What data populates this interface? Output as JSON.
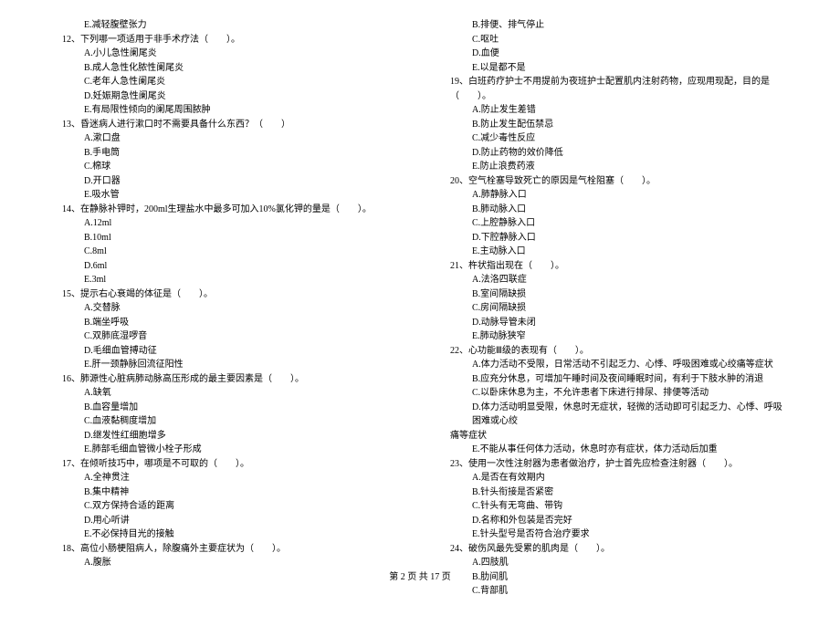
{
  "left_column": [
    {
      "type": "option",
      "text": "E.减轻腹壁张力"
    },
    {
      "type": "question",
      "text": "12、下列哪一项适用于非手术疗法（　　）。"
    },
    {
      "type": "option",
      "text": "A.小儿急性阑尾炎"
    },
    {
      "type": "option",
      "text": "B.成人急性化脓性阑尾炎"
    },
    {
      "type": "option",
      "text": "C.老年人急性阑尾炎"
    },
    {
      "type": "option",
      "text": "D.妊娠期急性阑尾炎"
    },
    {
      "type": "option",
      "text": "E.有局限性倾向的阑尾周围脓肿"
    },
    {
      "type": "question",
      "text": "13、昏迷病人进行漱口时不需要具备什么东西？（　　）"
    },
    {
      "type": "option",
      "text": "A.漱口盘"
    },
    {
      "type": "option",
      "text": "B.手电筒"
    },
    {
      "type": "option",
      "text": "C.棉球"
    },
    {
      "type": "option",
      "text": "D.开口器"
    },
    {
      "type": "option",
      "text": "E.吸水管"
    },
    {
      "type": "question",
      "text": "14、在静脉补钾时，200ml生理盐水中最多可加入10%氯化钾的量是（　　）。"
    },
    {
      "type": "option",
      "text": "A.12ml"
    },
    {
      "type": "option",
      "text": "B.10ml"
    },
    {
      "type": "option",
      "text": "C.8ml"
    },
    {
      "type": "option",
      "text": "D.6ml"
    },
    {
      "type": "option",
      "text": "E.3ml"
    },
    {
      "type": "question",
      "text": "15、提示右心衰竭的体征是（　　）。"
    },
    {
      "type": "option",
      "text": "A.交替脉"
    },
    {
      "type": "option",
      "text": "B.端坐呼吸"
    },
    {
      "type": "option",
      "text": "C.双肺底湿啰音"
    },
    {
      "type": "option",
      "text": "D.毛细血管搏动征"
    },
    {
      "type": "option",
      "text": "E.肝一颈静脉回流征阳性"
    },
    {
      "type": "question",
      "text": "16、肺源性心脏病肺动脉高压形成的最主要因素是（　　）。"
    },
    {
      "type": "option",
      "text": "A.缺氧"
    },
    {
      "type": "option",
      "text": "B.血容量增加"
    },
    {
      "type": "option",
      "text": "C.血液黏稠度增加"
    },
    {
      "type": "option",
      "text": "D.继发性红细胞增多"
    },
    {
      "type": "option",
      "text": "E.肺部毛细血管微小栓子形成"
    },
    {
      "type": "question",
      "text": "17、在倾听技巧中，哪项是不可取的（　　）。"
    },
    {
      "type": "option",
      "text": "A.全神贯注"
    },
    {
      "type": "option",
      "text": "B.集中精神"
    },
    {
      "type": "option",
      "text": "C.双方保持合适的距离"
    },
    {
      "type": "option",
      "text": "D.用心听讲"
    },
    {
      "type": "option",
      "text": "E.不必保持目光的接触"
    },
    {
      "type": "question",
      "text": "18、高位小肠梗阻病人，除腹痛外主要症状为（　　）。"
    },
    {
      "type": "option",
      "text": "A.腹胀"
    }
  ],
  "right_column": [
    {
      "type": "option",
      "text": "B.排便、排气停止"
    },
    {
      "type": "option",
      "text": "C.呕吐"
    },
    {
      "type": "option",
      "text": "D.血便"
    },
    {
      "type": "option",
      "text": "E.以是都不是"
    },
    {
      "type": "question",
      "text": "19、白班药疗护士不用提前为夜班护士配置肌内注射药物，应现用现配，目的是（　　）。"
    },
    {
      "type": "option",
      "text": "A.防止发生差错"
    },
    {
      "type": "option",
      "text": "B.防止发生配伍禁忌"
    },
    {
      "type": "option",
      "text": "C.减少毒性反应"
    },
    {
      "type": "option",
      "text": "D.防止药物的效价降低"
    },
    {
      "type": "option",
      "text": "E.防止浪费药液"
    },
    {
      "type": "question",
      "text": "20、空气栓塞导致死亡的原因是气栓阻塞（　　）。"
    },
    {
      "type": "option",
      "text": "A.肺静脉入口"
    },
    {
      "type": "option",
      "text": "B.肺动脉入口"
    },
    {
      "type": "option",
      "text": "C.上腔静脉入口"
    },
    {
      "type": "option",
      "text": "D.下腔静脉入口"
    },
    {
      "type": "option",
      "text": "E.主动脉入口"
    },
    {
      "type": "question",
      "text": "21、杵状指出现在（　　）。"
    },
    {
      "type": "option",
      "text": "A.法洛四联症"
    },
    {
      "type": "option",
      "text": "B.室间隔缺损"
    },
    {
      "type": "option",
      "text": "C.房间隔缺损"
    },
    {
      "type": "option",
      "text": "D.动脉导管未闭"
    },
    {
      "type": "option",
      "text": "E.肺动脉狭窄"
    },
    {
      "type": "question",
      "text": "22、心功能Ⅲ级的表现有（　　）。"
    },
    {
      "type": "option",
      "text": "A.体力活动不受限，日常活动不引起乏力、心悸、呼吸困难或心绞痛等症状"
    },
    {
      "type": "option",
      "text": "B.应充分休息，可增加午睡时间及夜间睡眠时间，有利于下肢水肿的消退"
    },
    {
      "type": "option",
      "text": "C.以卧床休息为主，不允许患者下床进行排尿、排便等活动"
    },
    {
      "type": "option",
      "text": "D.体力活动明显受限，休息时无症状，轻微的活动即可引起乏力、心悸、呼吸困难或心绞"
    },
    {
      "type": "continuation",
      "text": "痛等症状"
    },
    {
      "type": "option",
      "text": "E.不能从事任何体力活动，休息时亦有症状，体力活动后加重"
    },
    {
      "type": "question",
      "text": "23、使用一次性注射器为患者做治疗，护士首先应检查注射器（　　）。"
    },
    {
      "type": "option",
      "text": "A.是否在有效期内"
    },
    {
      "type": "option",
      "text": "B.针头衔接是否紧密"
    },
    {
      "type": "option",
      "text": "C.针头有无弯曲、带钩"
    },
    {
      "type": "option",
      "text": "D.名称和外包装是否完好"
    },
    {
      "type": "option",
      "text": "E.针头型号是否符合治疗要求"
    },
    {
      "type": "question",
      "text": "24、破伤风最先受累的肌肉是（　　）。"
    },
    {
      "type": "option",
      "text": "A.四肢肌"
    },
    {
      "type": "option",
      "text": "B.肋间肌"
    },
    {
      "type": "option",
      "text": "C.背部肌"
    }
  ],
  "footer": "第 2 页 共 17 页"
}
